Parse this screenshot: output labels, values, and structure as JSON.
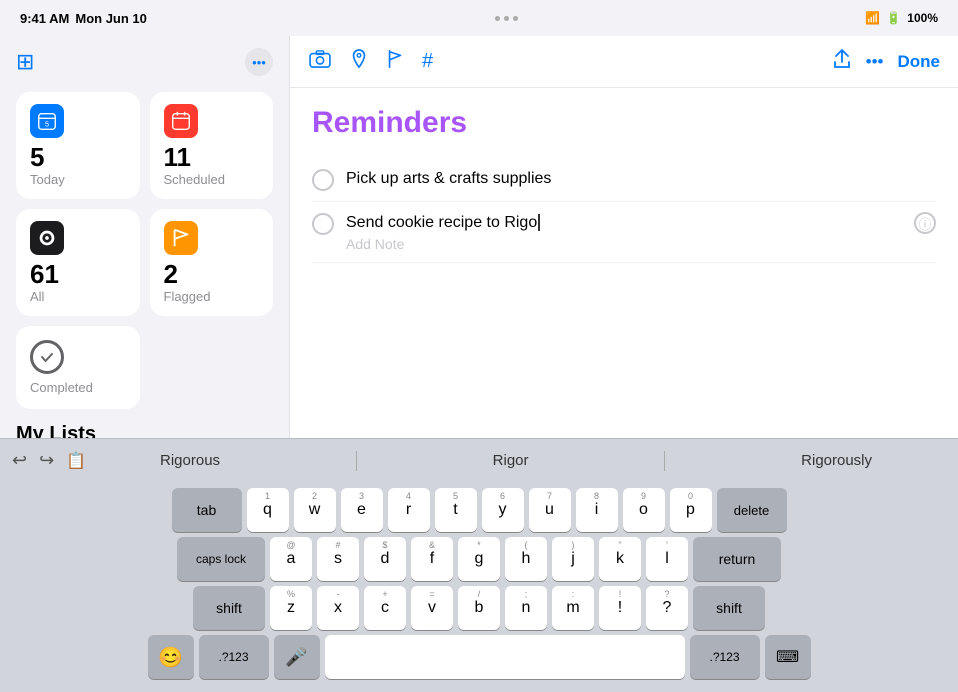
{
  "statusBar": {
    "time": "9:41 AM",
    "date": "Mon Jun 10",
    "dots": [
      "•",
      "•",
      "•"
    ],
    "wifi": "WiFi",
    "battery": "100%"
  },
  "sidebar": {
    "moreButton": "•••",
    "smartLists": [
      {
        "id": "today",
        "label": "Today",
        "count": "5",
        "iconBg": "#007aff",
        "iconChar": "📅"
      },
      {
        "id": "scheduled",
        "label": "Scheduled",
        "count": "11",
        "iconBg": "#ff3b30",
        "iconChar": "📅"
      },
      {
        "id": "all",
        "label": "All",
        "count": "61",
        "iconBg": "#1c1c1e",
        "iconChar": "●"
      },
      {
        "id": "flagged",
        "label": "Flagged",
        "count": "2",
        "iconBg": "#ff9500",
        "iconChar": "⚑"
      }
    ],
    "completed": {
      "label": "Completed"
    },
    "myListsLabel": "My Lists"
  },
  "detail": {
    "title": "Reminders",
    "toolbar": {
      "icons": [
        "📷",
        "📍",
        "🚩",
        "#"
      ],
      "share": "share",
      "more": "•••",
      "done": "Done"
    },
    "reminders": [
      {
        "id": "r1",
        "text": "Pick up arts & crafts supplies",
        "note": ""
      },
      {
        "id": "r2",
        "text": "Send cookie recipe to Rigo",
        "note": "Add Note"
      }
    ]
  },
  "keyboard": {
    "autocorrect": {
      "suggestions": [
        "Rigorous",
        "Rigor",
        "Rigorously"
      ]
    },
    "rows": [
      {
        "keys": [
          {
            "label": "tab",
            "type": "special",
            "class": "key-tab"
          },
          {
            "label": "q",
            "number": "1"
          },
          {
            "label": "w",
            "number": "2"
          },
          {
            "label": "e",
            "number": "3"
          },
          {
            "label": "r",
            "number": "4"
          },
          {
            "label": "t",
            "number": "5"
          },
          {
            "label": "y",
            "number": "6"
          },
          {
            "label": "u",
            "number": "7"
          },
          {
            "label": "i",
            "number": "8"
          },
          {
            "label": "o",
            "number": "9"
          },
          {
            "label": "p",
            "number": "0"
          },
          {
            "label": "delete",
            "type": "special",
            "class": "key-delete"
          }
        ]
      },
      {
        "keys": [
          {
            "label": "caps lock",
            "type": "special",
            "class": "key-capslock"
          },
          {
            "label": "a",
            "number": "@"
          },
          {
            "label": "s",
            "number": "#"
          },
          {
            "label": "d",
            "number": "$"
          },
          {
            "label": "f",
            "number": "&"
          },
          {
            "label": "g",
            "number": "*"
          },
          {
            "label": "h",
            "number": "("
          },
          {
            "label": "j",
            "number": ")"
          },
          {
            "label": "k",
            "number": "\""
          },
          {
            "label": "l",
            "number": "'"
          },
          {
            "label": "return",
            "type": "special",
            "class": "key-return"
          }
        ]
      },
      {
        "keys": [
          {
            "label": "shift",
            "type": "special",
            "class": "key-shift-left"
          },
          {
            "label": "z",
            "number": "%"
          },
          {
            "label": "x",
            "number": "-"
          },
          {
            "label": "c",
            "number": "+"
          },
          {
            "label": "v",
            "number": "="
          },
          {
            "label": "b",
            "number": "/"
          },
          {
            "label": "n",
            "number": ";"
          },
          {
            "label": "m",
            "number": ":"
          },
          {
            "label": "!",
            "number": "!"
          },
          {
            "label": "?",
            "number": "?"
          },
          {
            "label": "shift",
            "type": "special",
            "class": "key-shift-right"
          }
        ]
      },
      {
        "type": "bottom",
        "keys": [
          {
            "label": "😊",
            "type": "special",
            "class": "key-emoji"
          },
          {
            "label": ".?123",
            "type": "special",
            "class": "key-numbers"
          },
          {
            "label": "🎤",
            "type": "special",
            "class": "key-mic"
          },
          {
            "label": "",
            "type": "space",
            "class": "key-space"
          },
          {
            "label": ".?123",
            "type": "special",
            "class": "key-numbers2"
          },
          {
            "label": "⌨",
            "type": "special",
            "class": "key-kb"
          }
        ]
      }
    ]
  }
}
